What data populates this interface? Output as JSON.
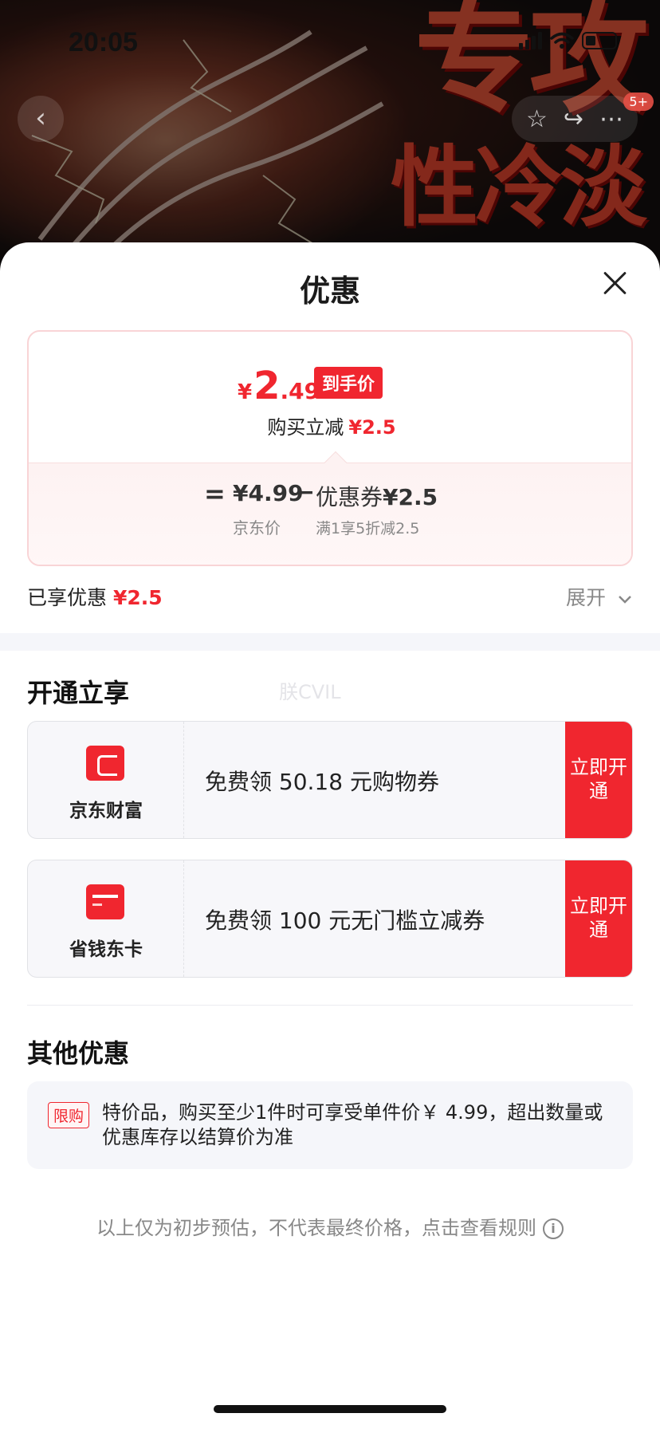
{
  "status_bar": {
    "time": "20:05"
  },
  "background": {
    "headline_line1": "专攻",
    "headline_line2": "性冷淡",
    "cart_badge": "5+"
  },
  "sheet": {
    "title": "优惠",
    "price": {
      "currency": "¥",
      "integer": "2",
      "decimal": ".49",
      "tag": "到手价",
      "reduce_label": "购买立减",
      "reduce_value": "¥2.5"
    },
    "formula": {
      "equals": "=",
      "jd_price": "¥4.99",
      "minus": "−",
      "coupon_label": "优惠券",
      "coupon_value": "¥2.5",
      "jd_price_label": "京东价",
      "coupon_rule": "满1享5折减2.5"
    },
    "enjoyed": {
      "label": "已享优惠",
      "value": "¥2.5"
    },
    "expand_label": "展开",
    "open_section": {
      "title": "开通立享",
      "watermark": "朕CVIL",
      "offers": [
        {
          "brand": "京东财富",
          "text": "免费领 50.18 元购物券",
          "button": "立即开通"
        },
        {
          "brand": "省钱东卡",
          "text": "免费领 100 元无门槛立减券",
          "button": "立即开通"
        }
      ]
    },
    "other_section": {
      "title": "其他优惠",
      "tag": "限购",
      "message": "特价品，购买至少1件时可享受单件价￥ 4.99，超出数量或优惠库存以结算价为准"
    },
    "footnote": "以上仅为初步预估，不代表最终价格，点击查看规则",
    "colors": {
      "accent": "#f0262f",
      "card_border": "#f9d4d6",
      "muted": "#888888"
    }
  }
}
